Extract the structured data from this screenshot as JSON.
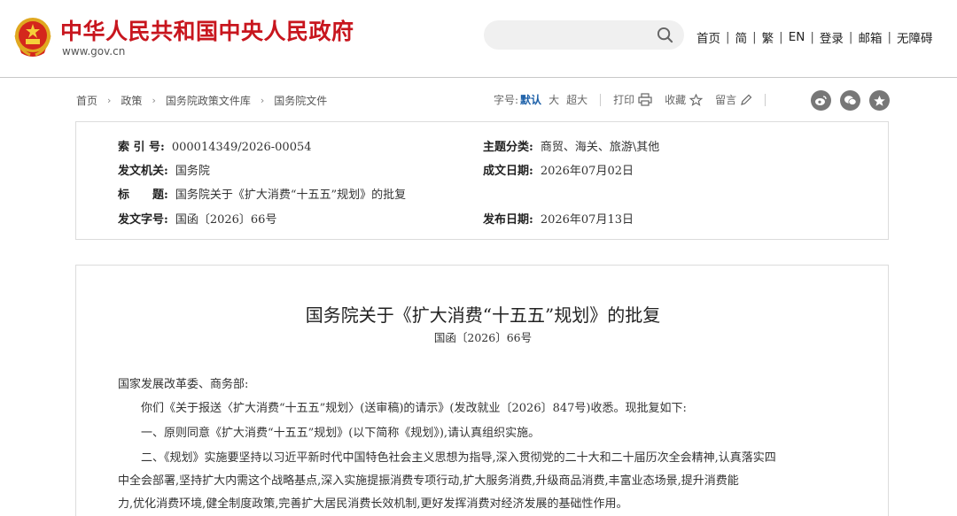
{
  "header": {
    "site_title": "中华人民共和国中央人民政府",
    "site_url": "www.gov.cn",
    "nav": [
      "首页",
      "简",
      "繁",
      "EN",
      "登录",
      "邮箱",
      "无障碍"
    ],
    "separator": "|",
    "brand_color": "#c8161e"
  },
  "breadcrumb": {
    "items": [
      "首页",
      "政策",
      "国务院政策文件库",
      "国务院文件"
    ],
    "arrow": "›"
  },
  "toolbar": {
    "font_size_label": "字号:",
    "font_sizes": [
      "默认",
      "大",
      "超大"
    ],
    "print": "打印",
    "favorite": "收藏",
    "comment": "留言",
    "share_icons": [
      "weibo-icon",
      "wechat-icon",
      "qzone-icon"
    ]
  },
  "info": {
    "index_label": "索 引 号:",
    "index_value": "000014349/2026-00054",
    "topic_label": "主题分类:",
    "topic_value": "商贸、海关、旅游\\其他",
    "issuer_label": "发文机关:",
    "issuer_value": "国务院",
    "written_label": "成文日期:",
    "written_value": "2026年07月02日",
    "title_label": "标　　题:",
    "title_value": "国务院关于《扩大消费“十五五”规划》的批复",
    "docno_label": "发文字号:",
    "docno_value": "国函〔2026〕66号",
    "published_label": "发布日期:",
    "published_value": "2026年07月13日"
  },
  "document": {
    "title": "国务院关于《扩大消费“十五五”规划》的批复",
    "number": "国函〔2026〕66号",
    "salutation": "国家发展改革委、商务部:",
    "para1": "你们《关于报送〈扩大消费“十五五”规划〉(送审稿)的请示》(发改就业〔2026〕847号)收悉。现批复如下:",
    "para2": "一、原则同意《扩大消费“十五五”规划》(以下简称《规划》),请认真组织实施。",
    "para3_line1": "二、《规划》实施要坚持以习近平新时代中国特色社会主义思想为指导,深入贯彻党的二十大和二十届历次全会精神,认真落实四",
    "para3_line2": "中全会部署,坚持扩大内需这个战略基点,深入实施提振消费专项行动,扩大服务消费,升级商品消费,丰富业态场景,提升消费能",
    "para3_line3": "力,优化消费环境,健全制度政策,完善扩大居民消费长效机制,更好发挥消费对经济发展的基础性作用。"
  }
}
